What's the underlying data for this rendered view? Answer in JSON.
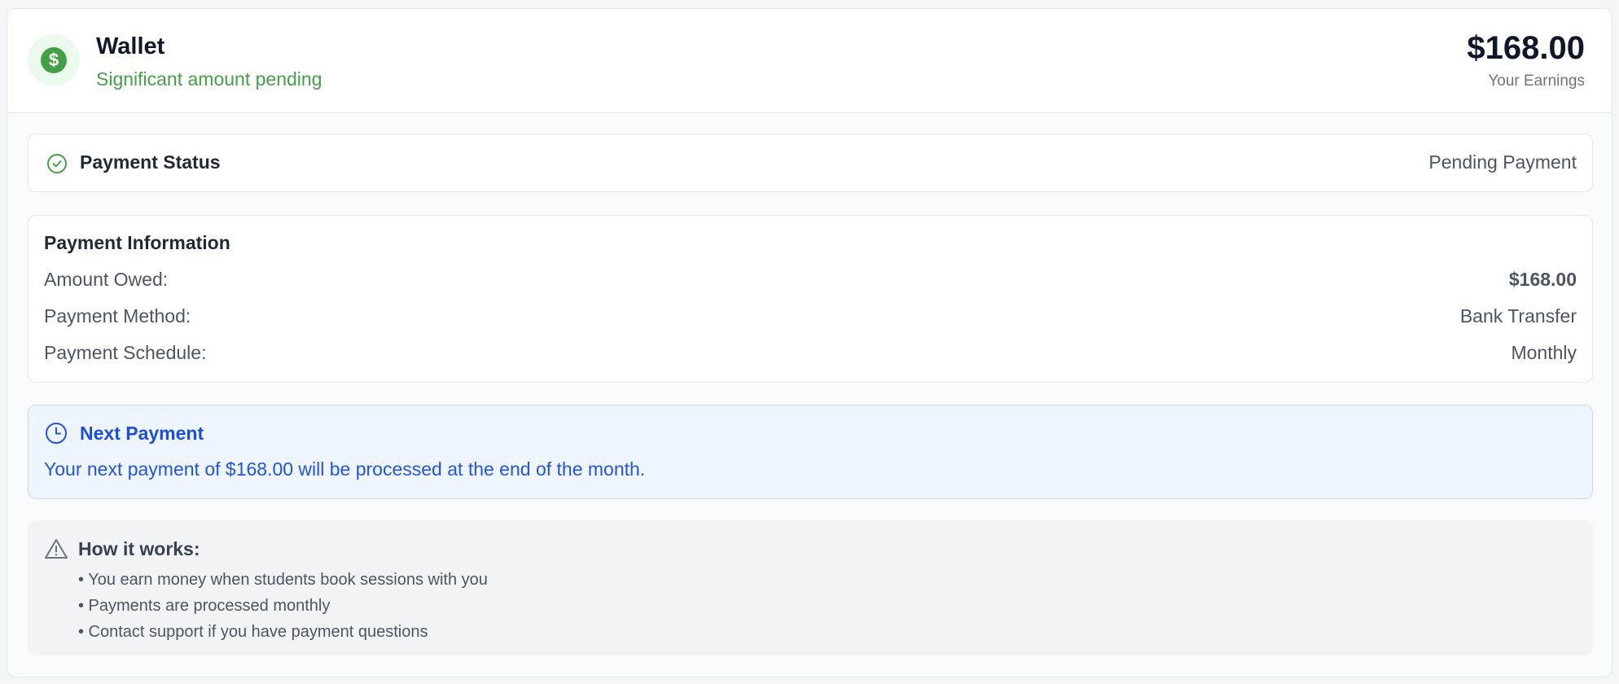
{
  "header": {
    "title": "Wallet",
    "subtitle": "Significant amount pending",
    "icon": "dollar-icon",
    "earnings_amount": "$168.00",
    "earnings_label": "Your Earnings"
  },
  "status": {
    "icon": "check-circle-icon",
    "label": "Payment Status",
    "value": "Pending Payment"
  },
  "payment_info": {
    "heading": "Payment Information",
    "rows": [
      {
        "label": "Amount Owed:",
        "value": "$168.00"
      },
      {
        "label": "Payment Method:",
        "value": "Bank Transfer"
      },
      {
        "label": "Payment Schedule:",
        "value": "Monthly"
      }
    ]
  },
  "next_payment": {
    "icon": "clock-icon",
    "title": "Next Payment",
    "text": "Your next payment of $168.00 will be processed at the end of the month."
  },
  "how_it_works": {
    "icon": "warning-triangle-icon",
    "title": "How it works:",
    "items": [
      "• You earn money when students book sessions with you",
      "• Payments are processed monthly",
      "• Contact support if you have payment questions"
    ]
  },
  "colors": {
    "accent_green": "#43a047",
    "accent_blue": "#1d4ed8",
    "info_bg": "#eff5fe"
  }
}
